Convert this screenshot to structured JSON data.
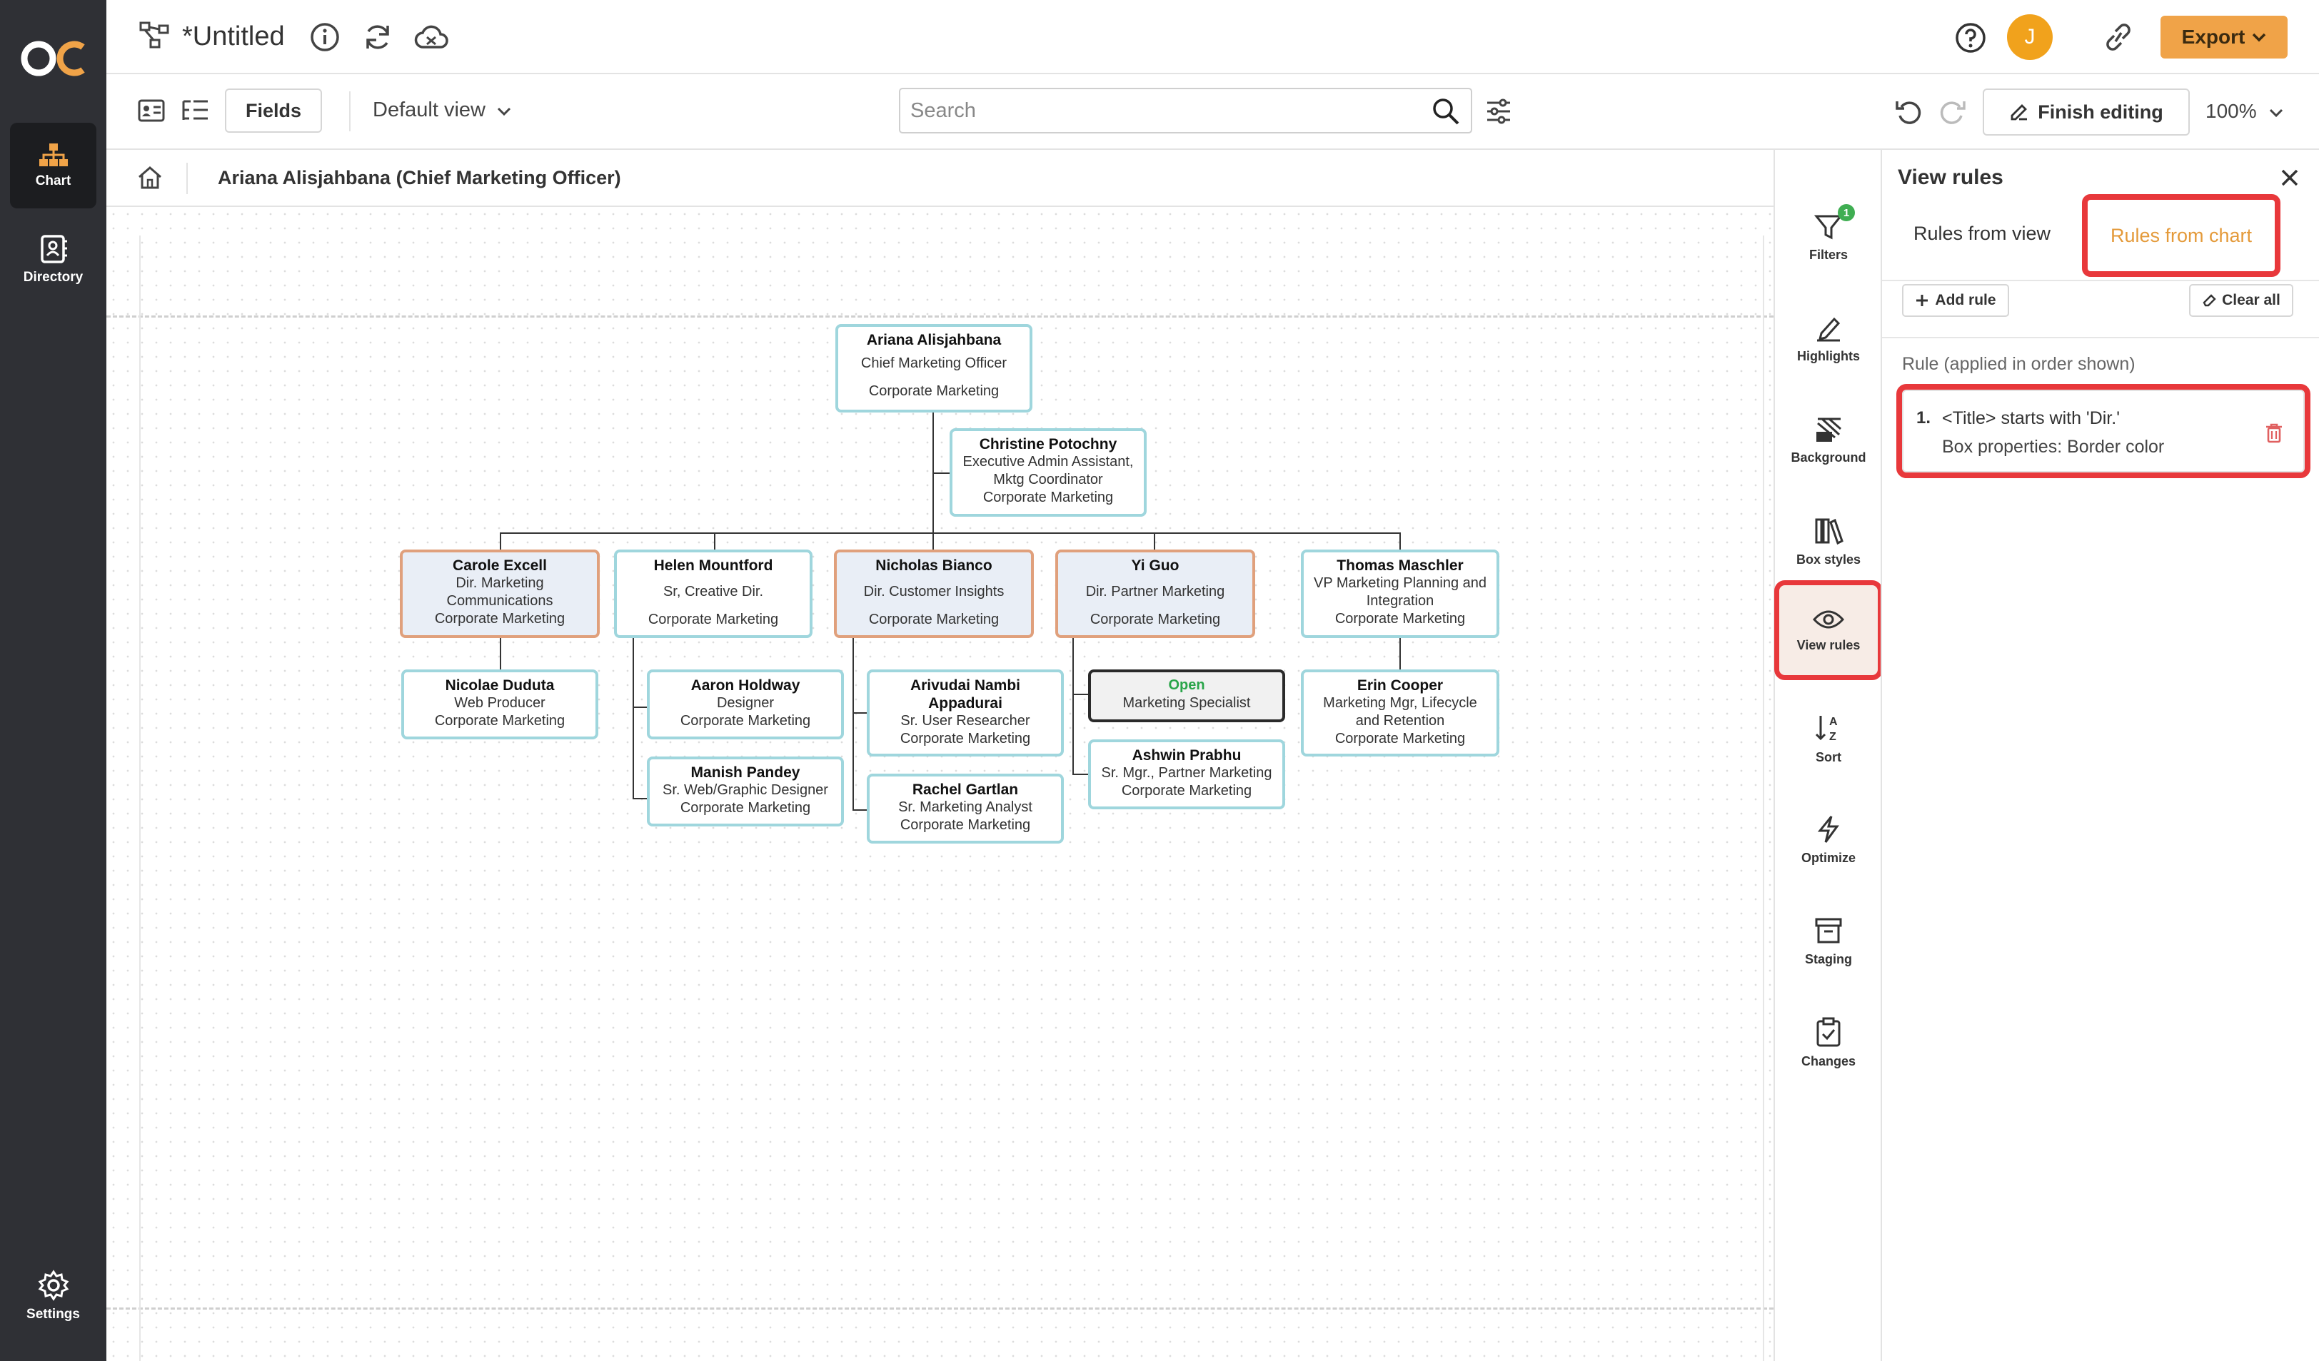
{
  "app": {
    "title": "*Untitled",
    "logo_text": "OC",
    "avatar_initial": "J",
    "export_label": "Export",
    "accent": "#f0a348"
  },
  "rail": {
    "items": [
      {
        "label": "Chart",
        "icon": "org-chart-icon"
      },
      {
        "label": "Directory",
        "icon": "directory-icon"
      }
    ],
    "settings_label": "Settings"
  },
  "toolbar": {
    "fields_label": "Fields",
    "view_label": "Default view",
    "search_placeholder": "Search",
    "finish_label": "Finish editing",
    "zoom": "100%"
  },
  "breadcrumb": {
    "current": "Ariana Alisjahbana (Chief Marketing Officer)"
  },
  "org": {
    "root": {
      "name": "Ariana Alisjahbana",
      "title": "Chief Marketing Officer",
      "dept": "Corporate Marketing"
    },
    "assistant": {
      "name": "Christine Potochny",
      "title1": "Executive Admin Assistant,",
      "title2": "Mktg Coordinator",
      "dept": "Corporate Marketing"
    },
    "level1": [
      {
        "name": "Carole Excell",
        "title1": "Dir. Marketing",
        "title2": "Communications",
        "dept": "Corporate Marketing"
      },
      {
        "name": "Helen Mountford",
        "title1": "Sr, Creative Dir.",
        "dept": "Corporate Marketing"
      },
      {
        "name": "Nicholas Bianco",
        "title1": "Dir. Customer Insights",
        "dept": "Corporate Marketing"
      },
      {
        "name": "Yi Guo",
        "title1": "Dir. Partner Marketing",
        "dept": "Corporate Marketing"
      },
      {
        "name": "Thomas Maschler",
        "title1": "VP Marketing Planning and",
        "title2": "Integration",
        "dept": "Corporate Marketing"
      }
    ],
    "nicolae": {
      "name": "Nicolae Duduta",
      "title": "Web Producer",
      "dept": "Corporate Marketing"
    },
    "aaron": {
      "name": "Aaron Holdway",
      "title": "Designer",
      "dept": "Corporate Marketing"
    },
    "manish": {
      "name": "Manish Pandey",
      "title": "Sr. Web/Graphic Designer",
      "dept": "Corporate Marketing"
    },
    "arivudai": {
      "name1": "Arivudai Nambi",
      "name2": "Appadurai",
      "title": "Sr. User Researcher",
      "dept": "Corporate Marketing"
    },
    "rachel": {
      "name": "Rachel Gartlan",
      "title": "Sr. Marketing Analyst",
      "dept": "Corporate Marketing"
    },
    "open": {
      "name": "Open",
      "title": "Marketing Specialist"
    },
    "ashwin": {
      "name": "Ashwin Prabhu",
      "title": "Sr. Mgr., Partner Marketing",
      "dept": "Corporate Marketing"
    },
    "erin": {
      "name": "Erin Cooper",
      "title1": "Marketing Mgr, Lifecycle",
      "title2": "and Retention",
      "dept": "Corporate Marketing"
    }
  },
  "sidebar": {
    "items": [
      {
        "label": "Filters",
        "icon": "filter-icon",
        "badge": "1"
      },
      {
        "label": "Highlights",
        "icon": "highlight-icon"
      },
      {
        "label": "Background",
        "icon": "background-icon"
      },
      {
        "label": "Box styles",
        "icon": "box-styles-icon"
      },
      {
        "label": "View rules",
        "icon": "eye-icon"
      },
      {
        "label": "Sort",
        "icon": "sort-icon"
      },
      {
        "label": "Optimize",
        "icon": "lightning-icon"
      },
      {
        "label": "Staging",
        "icon": "archive-icon"
      },
      {
        "label": "Changes",
        "icon": "clipboard-check-icon"
      }
    ]
  },
  "panel": {
    "title": "View rules",
    "tab_view": "Rules from view",
    "tab_chart": "Rules from chart",
    "add_rule": "Add rule",
    "clear_all": "Clear all",
    "rule_heading": "Rule (applied in order shown)",
    "rules": [
      {
        "num": "1.",
        "condition": "<Title> starts with 'Dir.'",
        "action": "Box properties: Border color"
      }
    ]
  }
}
